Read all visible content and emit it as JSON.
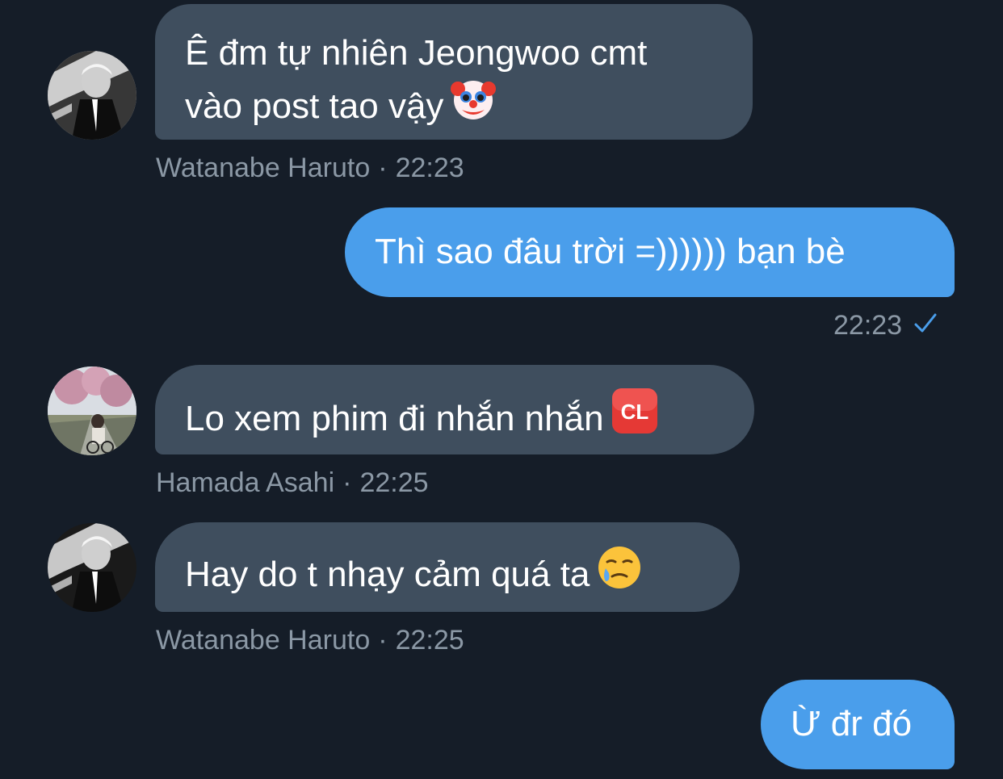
{
  "messages": [
    {
      "text_line1": "Ê đm tự nhiên Jeongwoo cmt",
      "text_line2": "vào post tao vậy",
      "emoji": "clown-face",
      "sender": "Watanabe Haruto",
      "time": "22:23"
    },
    {
      "text": "Thì sao đâu trời =)))))) bạn bè",
      "time": "22:23",
      "status_icon": "checkmark-icon"
    },
    {
      "text": "Lo xem phim đi nhắn nhắn",
      "emoji": "cl-button",
      "emoji_label": "CL",
      "sender": "Hamada Asahi",
      "time": "22:25"
    },
    {
      "text": "Hay do t nhạy cảm quá ta",
      "emoji": "face-holding-back-tears",
      "sender": "Watanabe Haruto",
      "time": "22:25"
    },
    {
      "text": "Ừ đr đó"
    }
  ],
  "colors": {
    "background": "#151d28",
    "incoming_bubble": "#3f4e5e",
    "outgoing_bubble": "#4a9eeb",
    "meta_text": "#8b98a5",
    "check": "#4a9eeb"
  },
  "separator": "·"
}
